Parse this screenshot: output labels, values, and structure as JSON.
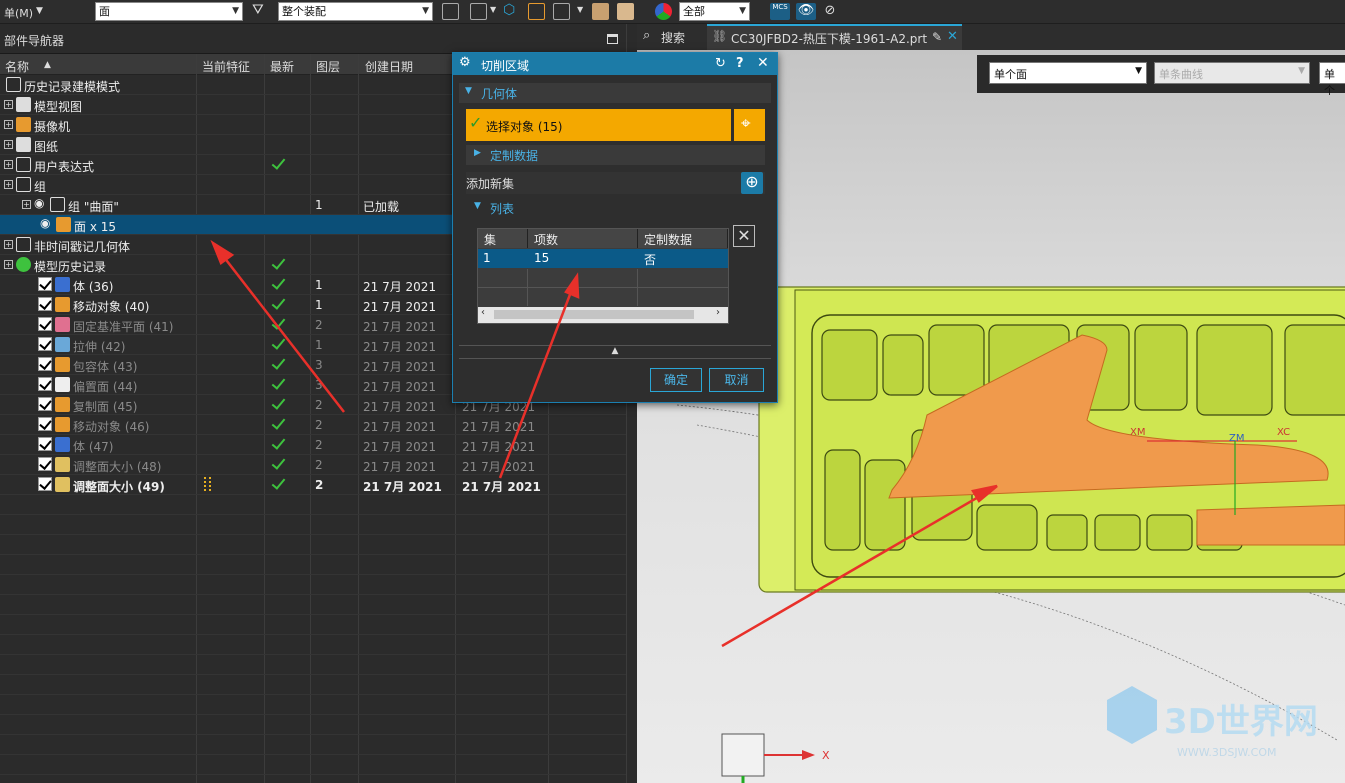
{
  "toolbar": {
    "menu_label": "单(M)",
    "select_filter": "面",
    "assembly_scope": "整个装配",
    "visibility": "全部",
    "mcs_label": "MCS"
  },
  "navigator": {
    "title": "部件导航器",
    "columns": [
      "名称",
      "当前特征",
      "最新",
      "图层",
      "创建日期"
    ],
    "rows": [
      {
        "label": "历史记录建模模式",
        "layer": "",
        "date": "",
        "date2": "",
        "latest": false,
        "dim": false,
        "bold": false,
        "sel": false
      },
      {
        "label": "模型视图",
        "layer": "",
        "date": "",
        "date2": "",
        "latest": false,
        "dim": false,
        "bold": false,
        "sel": false
      },
      {
        "label": "摄像机",
        "layer": "",
        "date": "",
        "date2": "",
        "latest": false,
        "dim": false,
        "bold": false,
        "sel": false
      },
      {
        "label": "图纸",
        "layer": "",
        "date": "",
        "date2": "",
        "latest": false,
        "dim": false,
        "bold": false,
        "sel": false
      },
      {
        "label": "用户表达式",
        "layer": "",
        "date": "",
        "date2": "",
        "latest": true,
        "dim": false,
        "bold": false,
        "sel": false
      },
      {
        "label": "组",
        "layer": "",
        "date": "",
        "date2": "",
        "latest": false,
        "dim": false,
        "bold": false,
        "sel": false
      },
      {
        "label": "组 \"曲面\"",
        "layer": "1",
        "date": "已加载",
        "date2": "",
        "latest": false,
        "dim": false,
        "bold": false,
        "sel": false
      },
      {
        "label": "面 x 15",
        "layer": "",
        "date": "",
        "date2": "",
        "latest": false,
        "dim": false,
        "bold": false,
        "sel": true
      },
      {
        "label": "非时间戳记几何体",
        "layer": "",
        "date": "",
        "date2": "",
        "latest": false,
        "dim": false,
        "bold": false,
        "sel": false
      },
      {
        "label": "模型历史记录",
        "layer": "",
        "date": "",
        "date2": "",
        "latest": true,
        "dim": false,
        "bold": false,
        "sel": false
      },
      {
        "label": "体 (36)",
        "layer": "1",
        "date": "21 7月 2021",
        "date2": "",
        "latest": true,
        "dim": false,
        "bold": false,
        "sel": false
      },
      {
        "label": "移动对象 (40)",
        "layer": "1",
        "date": "21 7月 2021",
        "date2": "",
        "latest": true,
        "dim": false,
        "bold": false,
        "sel": false
      },
      {
        "label": "固定基准平面 (41)",
        "layer": "2",
        "date": "21 7月 2021",
        "date2": "",
        "latest": true,
        "dim": true,
        "bold": false,
        "sel": false
      },
      {
        "label": "拉伸 (42)",
        "layer": "1",
        "date": "21 7月 2021",
        "date2": "",
        "latest": true,
        "dim": true,
        "bold": false,
        "sel": false
      },
      {
        "label": "包容体 (43)",
        "layer": "3",
        "date": "21 7月 2021",
        "date2": "",
        "latest": true,
        "dim": true,
        "bold": false,
        "sel": false
      },
      {
        "label": "偏置面 (44)",
        "layer": "3",
        "date": "21 7月 2021",
        "date2": "",
        "latest": true,
        "dim": true,
        "bold": false,
        "sel": false
      },
      {
        "label": "复制面 (45)",
        "layer": "2",
        "date": "21 7月 2021",
        "date2": "21 7月 2021",
        "latest": true,
        "dim": true,
        "bold": false,
        "sel": false
      },
      {
        "label": "移动对象 (46)",
        "layer": "2",
        "date": "21 7月 2021",
        "date2": "21 7月 2021",
        "latest": true,
        "dim": true,
        "bold": false,
        "sel": false
      },
      {
        "label": "体 (47)",
        "layer": "2",
        "date": "21 7月 2021",
        "date2": "21 7月 2021",
        "latest": true,
        "dim": true,
        "bold": false,
        "sel": false
      },
      {
        "label": "调整面大小 (48)",
        "layer": "2",
        "date": "21 7月 2021",
        "date2": "21 7月 2021",
        "latest": true,
        "dim": true,
        "bold": false,
        "sel": false
      },
      {
        "label": "调整面大小 (49)",
        "layer": "2",
        "date": "21 7月 2021",
        "date2": "21 7月 2021",
        "latest": true,
        "dim": false,
        "bold": true,
        "sel": false
      }
    ]
  },
  "tabs": {
    "search": "搜索",
    "file": "CC30JFBD2-热压下模-1961-A2.prt"
  },
  "viewport": {
    "filter1": "单个面",
    "filter2": "单条曲线",
    "filter3": "单个",
    "axis_xm": "XM",
    "axis_zm": "ZM",
    "axis_xc": "XC",
    "axis_x": "X",
    "watermark": "3D世界网",
    "watermark_url": "WWW.3DSJW.COM"
  },
  "dialog": {
    "title": "切削区域",
    "geometry_section": "几何体",
    "select_object": "选择对象 (15)",
    "custom_data": "定制数据",
    "add_new_set": "添加新集",
    "list_section": "列表",
    "table_headers": [
      "集",
      "项数",
      "定制数据"
    ],
    "table_rows": [
      {
        "set": "1",
        "count": "15",
        "custom": "否"
      }
    ],
    "ok": "确定",
    "cancel": "取消"
  },
  "colors": {
    "accent": "#1c7ba7",
    "selection_bar": "#f4a800",
    "model_yellow": "#d8ef58",
    "model_orange": "#f09a4c",
    "arrow_red": "#e8302a"
  }
}
